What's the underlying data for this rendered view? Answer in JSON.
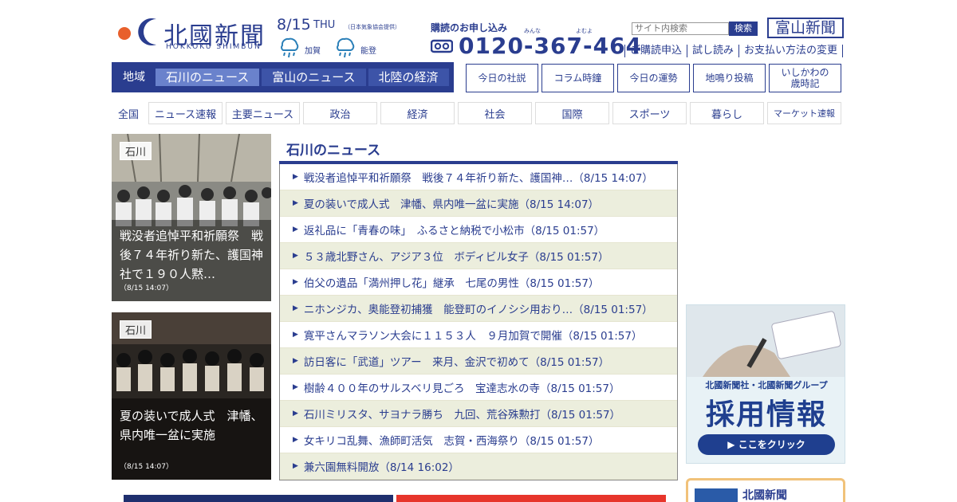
{
  "header": {
    "logo_text": "北國新聞",
    "logo_sub": "HOKKOKU SHIMBUN",
    "date": "8/15",
    "weekday": "THU",
    "weather_source": "（日本気象協会提供）",
    "weather": [
      {
        "icon": "rain-icon",
        "label": "加賀"
      },
      {
        "icon": "rain-icon",
        "label": "能登"
      }
    ],
    "subscribe_label": "購読のお申し込み",
    "phone_ruby": [
      "みんな",
      "よむよ"
    ],
    "phone": "0120-367-464",
    "search_placeholder": "サイト内検索",
    "search_button": "検索",
    "toyama_logo": "富山新聞",
    "toplinks": [
      "ご購読申込",
      "試し読み",
      "お支払い方法の変更"
    ]
  },
  "mainnav": {
    "region_label": "地域",
    "tabs": [
      {
        "label": "石川のニュース",
        "active": true
      },
      {
        "label": "富山のニュース",
        "active": false
      },
      {
        "label": "北陸の経済",
        "active": false
      }
    ]
  },
  "boxlinks": [
    "今日の社説",
    "コラム時鐘",
    "今日の運勢",
    "地鳴り投稿",
    "いしかわの\n歳時記"
  ],
  "catnav": {
    "all_label": "全国",
    "items": [
      "ニュース速報",
      "主要ニュース",
      "政治",
      "経済",
      "社会",
      "国際",
      "スポーツ",
      "暮らし",
      "マーケット速報"
    ]
  },
  "photos": [
    {
      "tag": "石川",
      "caption": "戦没者追悼平和祈願祭　戦後７４年祈り新た、護国神社で１９０人黙…",
      "time": "（8/15 14:07）"
    },
    {
      "tag": "石川",
      "caption": "夏の装いで成人式　津幡、県内唯一盆に実施",
      "time": "（8/15 14:07）"
    }
  ],
  "news": {
    "title": "石川のニュース",
    "items": [
      "戦没者追悼平和祈願祭　戦後７４年祈り新た、護国神…（8/15 14:07）",
      "夏の装いで成人式　津幡、県内唯一盆に実施（8/15 14:07）",
      "返礼品に「青春の味」　ふるさと納税で小松市（8/15 01:57）",
      "５３歳北野さん、アジア３位　ボディビル女子（8/15 01:57）",
      "伯父の遺品「満州押し花」継承　七尾の男性（8/15 01:57）",
      "ニホンジカ、奥能登初捕獲　能登町のイノシシ用おり…（8/15 01:57）",
      "寛平さんマラソン大会に１１５３人　９月加賀で開催（8/15 01:57）",
      "訪日客に「武道」ツアー　来月、金沢で初めて（8/15 01:57）",
      "樹齢４００年のサルスベリ見ごろ　宝達志水の寺（8/15 01:57）",
      "石川ミリスタ、サヨナラ勝ち　九回、荒谷殊勲打（8/15 01:57）",
      "女キリコ乱舞、漁師町活気　志賀・西海祭り（8/15 01:57）",
      "兼六園無料開放（8/14 16:02）"
    ]
  },
  "ad": {
    "line1": "北國新聞社・北國新聞グループ",
    "line2": "採用情報",
    "button": "▶ ここをクリック"
  },
  "bottom_box": {
    "text": "北國新聞"
  },
  "colors": {
    "brand": "#2a3d8f",
    "active_tab": "#6a82cc",
    "stripe": "#eceedd"
  }
}
